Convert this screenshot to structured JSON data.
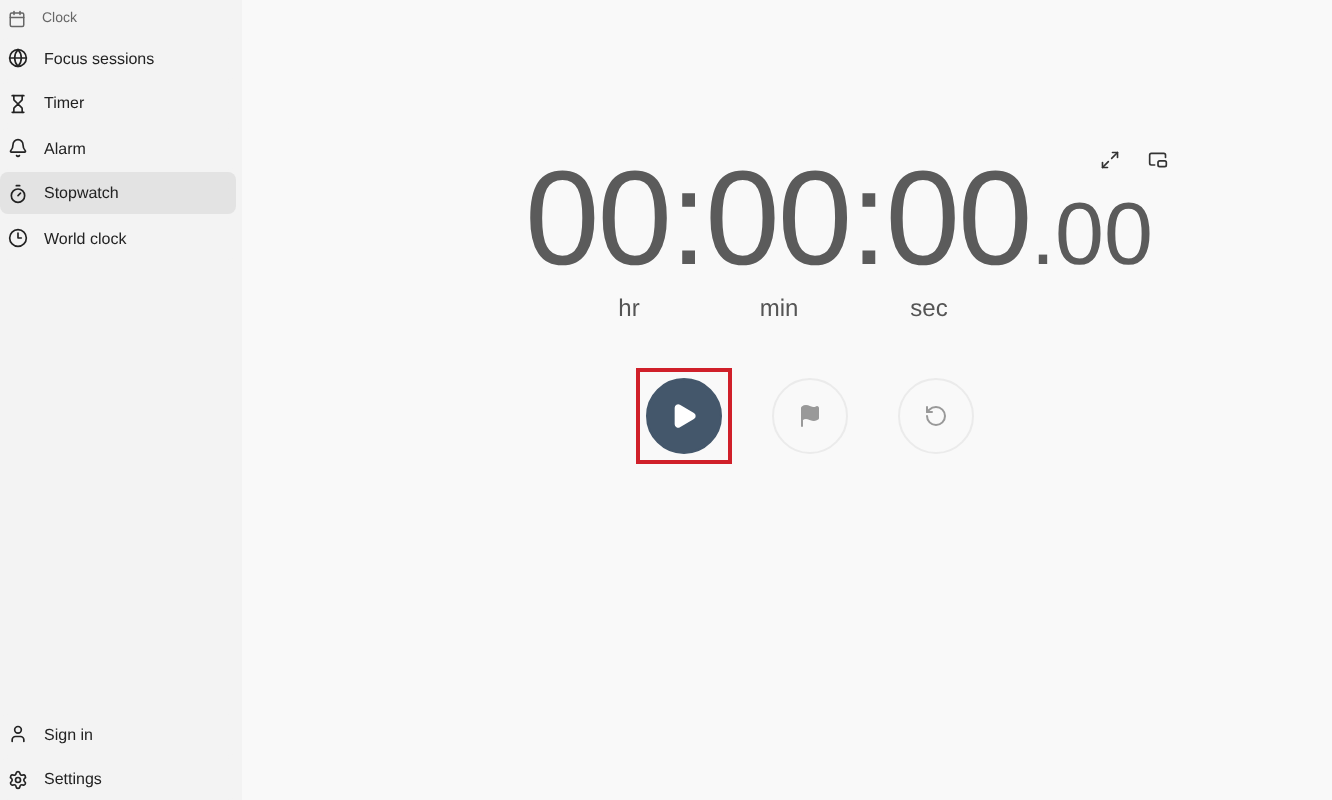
{
  "app_title": "Clock",
  "nav": [
    {
      "label": "Focus sessions",
      "selected": false
    },
    {
      "label": "Timer",
      "selected": false
    },
    {
      "label": "Alarm",
      "selected": false
    },
    {
      "label": "Stopwatch",
      "selected": true
    },
    {
      "label": "World clock",
      "selected": false
    }
  ],
  "footer_nav": [
    {
      "label": "Sign in"
    },
    {
      "label": "Settings"
    }
  ],
  "stopwatch": {
    "time": "00:00:00",
    "fraction": ".00",
    "units": [
      "hr",
      "min",
      "sec"
    ]
  },
  "controls": [
    {
      "kind": "play",
      "highlighted": true,
      "disabled": false
    },
    {
      "kind": "flag",
      "highlighted": false,
      "disabled": true
    },
    {
      "kind": "reset",
      "highlighted": false,
      "disabled": true
    }
  ]
}
